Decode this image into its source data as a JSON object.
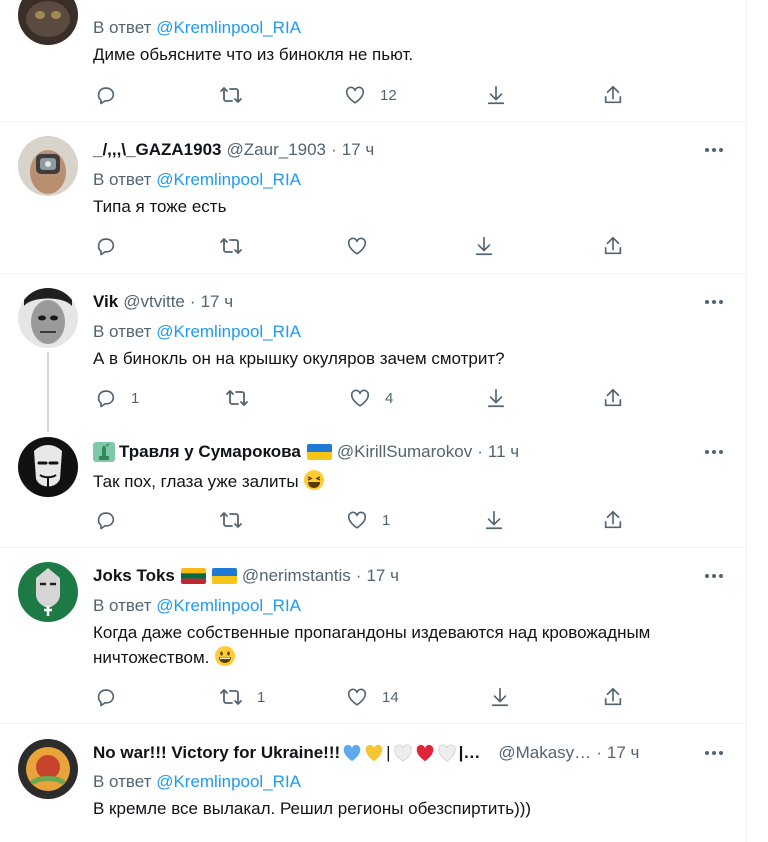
{
  "reply_prefix": "В ответ",
  "tweets": [
    {
      "name": "",
      "handle": "",
      "time": "",
      "reply_to": "@Kremlinpool_RIA",
      "text": "Диме обьясните что из бинокля не пьют.",
      "counts": {
        "reply": "",
        "retweet": "",
        "like": "12"
      }
    },
    {
      "name": "_/,,,\\_GAZA1903",
      "handle": "@Zaur_1903",
      "time": "17 ч",
      "reply_to": "@Kremlinpool_RIA",
      "text": "Типа я тоже есть",
      "counts": {
        "reply": "",
        "retweet": "",
        "like": ""
      }
    },
    {
      "name": "Vik",
      "handle": "@vtvitte",
      "time": "17 ч",
      "reply_to": "@Kremlinpool_RIA",
      "text": "А в бинокль он на крышку окуляров зачем смотрит?",
      "counts": {
        "reply": "1",
        "retweet": "",
        "like": "4"
      }
    },
    {
      "name": "Травля у Сумарокова",
      "handle": "@KirillSumarokov",
      "time": "11 ч",
      "reply_to": "",
      "text": "Так пох, глаза уже залиты",
      "counts": {
        "reply": "",
        "retweet": "",
        "like": "1"
      }
    },
    {
      "name": "Joks Toks",
      "handle": "@nerimstantis",
      "time": "17 ч",
      "reply_to": "@Kremlinpool_RIA",
      "text": "Когда даже собственные пропагандоны издеваются над кровожадным ничтожеством.",
      "counts": {
        "reply": "",
        "retweet": "1",
        "like": "14"
      }
    },
    {
      "name": "No war!!! Victory for Ukraine!!!",
      "name_suffix": "|…",
      "handle": "@Makasy…",
      "time": "17 ч",
      "reply_to": "@Kremlinpool_RIA",
      "text": "В кремле все вылакал. Решил регионы обезспиртить)))",
      "counts": {
        "reply": "",
        "retweet": "",
        "like": ""
      }
    }
  ],
  "colors": {
    "link": "#1d9bf0",
    "secondary": "#536471",
    "text": "#0f1419",
    "separator": "#eff3f4",
    "thread_line": "#cfd9de"
  },
  "icons": [
    "reply-icon",
    "retweet-icon",
    "like-icon",
    "download-icon",
    "share-icon",
    "more-icon"
  ]
}
